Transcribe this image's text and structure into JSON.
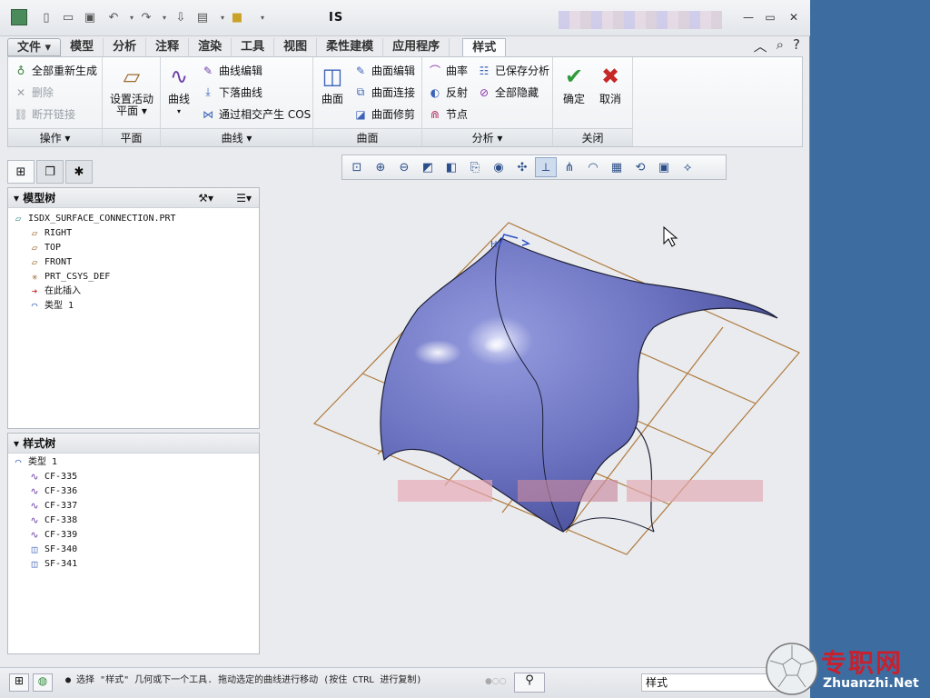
{
  "window": {
    "title": "IS"
  },
  "ribbon": {
    "tabs": [
      "文件 ▾",
      "模型",
      "分析",
      "注释",
      "渲染",
      "工具",
      "视图",
      "柔性建模",
      "应用程序",
      "样式"
    ],
    "groups": {
      "operations": {
        "label": "操作 ▾",
        "items": [
          "全部重新生成",
          "删除",
          "断开链接"
        ]
      },
      "plane": {
        "label": "平面",
        "set_active": "设置活动",
        "set_active_sub": "平面 ▾"
      },
      "curve": {
        "label": "曲线 ▾",
        "big": "曲线",
        "items": [
          "曲线编辑",
          "下落曲线",
          "通过相交产生 COS"
        ]
      },
      "surface": {
        "label": "曲面",
        "big": "曲面",
        "items": [
          "曲面编辑",
          "曲面连接",
          "曲面修剪"
        ]
      },
      "analysis": {
        "label": "分析 ▾",
        "items": [
          "曲率",
          "已保存分析",
          "反射",
          "全部隐藏",
          "节点"
        ]
      },
      "close": {
        "label": "关闭",
        "ok": "确定",
        "cancel": "取消"
      }
    }
  },
  "model_tree": {
    "header": "模型树",
    "items": [
      {
        "icon": "part-icon",
        "label": "ISDX_SURFACE_CONNECTION.PRT"
      },
      {
        "icon": "datum-plane-icon",
        "label": "RIGHT"
      },
      {
        "icon": "datum-plane-icon",
        "label": "TOP"
      },
      {
        "icon": "datum-plane-icon",
        "label": "FRONT"
      },
      {
        "icon": "csys-icon",
        "label": "PRT_CSYS_DEF"
      },
      {
        "icon": "insert-here-icon",
        "label": "在此插入"
      },
      {
        "icon": "style-feature-icon",
        "label": "类型 1"
      }
    ]
  },
  "style_tree": {
    "header": "样式树",
    "items": [
      {
        "icon": "style-feature-icon",
        "label": "类型 1",
        "indent": 0
      },
      {
        "icon": "curve-icon",
        "label": "CF-335",
        "indent": 1
      },
      {
        "icon": "curve-icon",
        "label": "CF-336",
        "indent": 1
      },
      {
        "icon": "curve-icon",
        "label": "CF-337",
        "indent": 1
      },
      {
        "icon": "curve-icon",
        "label": "CF-338",
        "indent": 1
      },
      {
        "icon": "curve-icon",
        "label": "CF-339",
        "indent": 1
      },
      {
        "icon": "surface-icon",
        "label": "SF-340",
        "indent": 1
      },
      {
        "icon": "surface-icon",
        "label": "SF-341",
        "indent": 1
      }
    ]
  },
  "status": {
    "message": "● 选择 \"样式\" 几何或下一个工具. 拖动选定的曲线进行移动 (按住 CTRL 进行复制)",
    "filter": "样式"
  },
  "watermark": {
    "cn": "专职网",
    "en": "Zhuanzhi.Net"
  },
  "colors": {
    "surface": "#6f77c4",
    "grid": "#b07a3e",
    "ok": "#2e9a3a",
    "cancel": "#c62828",
    "brand": "#c7212f"
  }
}
